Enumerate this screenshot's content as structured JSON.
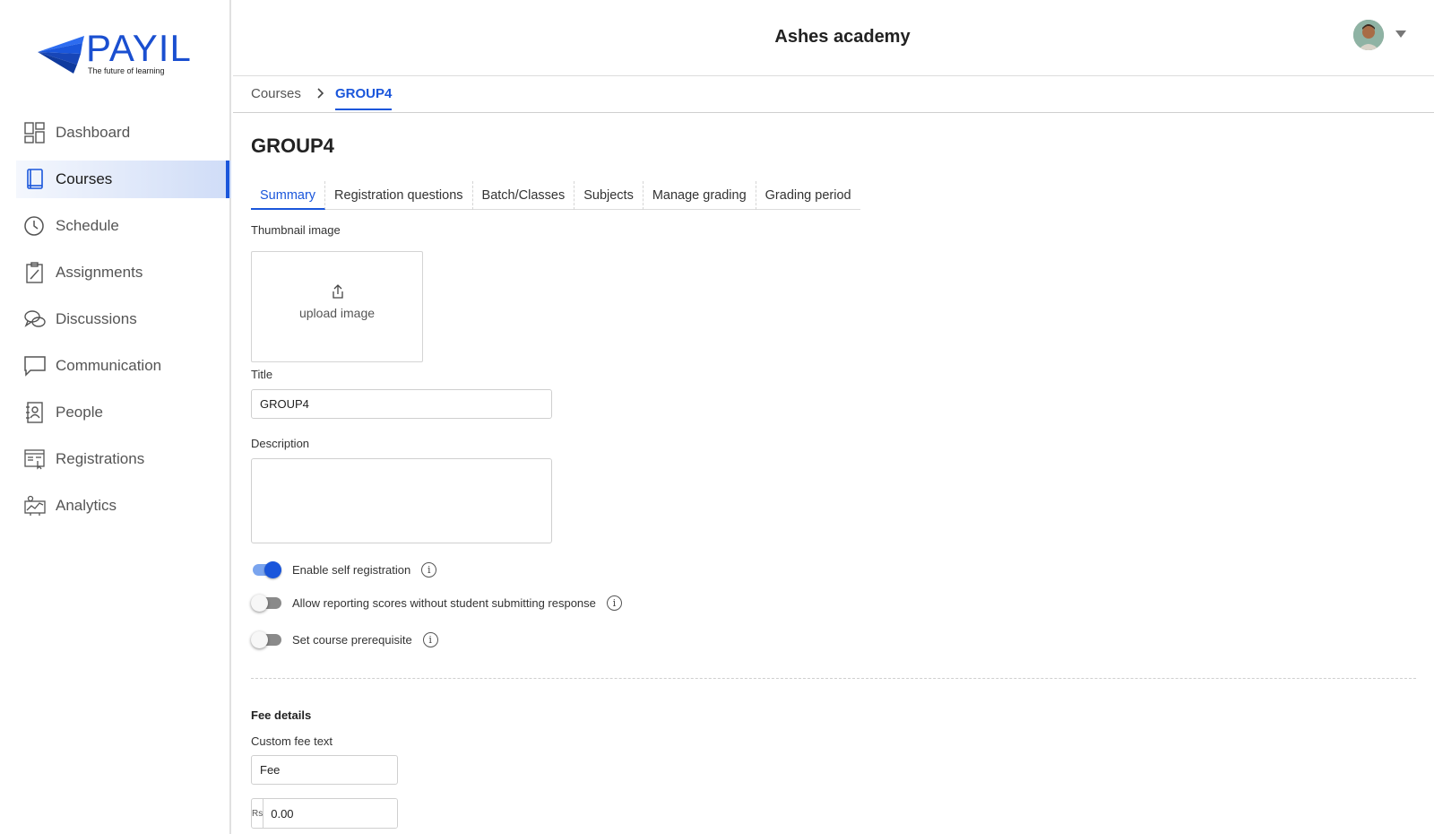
{
  "brand": {
    "name": "PAYIL",
    "tagline": "The future of learning",
    "accent": "#1a56db"
  },
  "header": {
    "title": "Ashes academy",
    "avatar_icon": "user-avatar",
    "menu_icon": "caret-down-icon"
  },
  "sidebar": {
    "items": [
      {
        "label": "Dashboard",
        "icon": "dashboard-icon",
        "active": false
      },
      {
        "label": "Courses",
        "icon": "book-icon",
        "active": true
      },
      {
        "label": "Schedule",
        "icon": "clock-icon",
        "active": false
      },
      {
        "label": "Assignments",
        "icon": "clipboard-icon",
        "active": false
      },
      {
        "label": "Discussions",
        "icon": "chat-bubbles-icon",
        "active": false
      },
      {
        "label": "Communication",
        "icon": "message-icon",
        "active": false
      },
      {
        "label": "People",
        "icon": "contacts-icon",
        "active": false
      },
      {
        "label": "Registrations",
        "icon": "form-icon",
        "active": false
      },
      {
        "label": "Analytics",
        "icon": "analytics-icon",
        "active": false
      }
    ]
  },
  "breadcrumb": {
    "root": "Courses",
    "separator": ">",
    "current": "GROUP4"
  },
  "page": {
    "title": "GROUP4",
    "tabs": [
      {
        "label": "Summary",
        "active": true
      },
      {
        "label": "Registration questions",
        "active": false
      },
      {
        "label": "Batch/Classes",
        "active": false
      },
      {
        "label": "Subjects",
        "active": false
      },
      {
        "label": "Manage grading",
        "active": false
      },
      {
        "label": "Grading period",
        "active": false
      }
    ]
  },
  "form": {
    "thumbnail": {
      "label": "Thumbnail image",
      "upload_text": "upload image"
    },
    "title": {
      "label": "Title",
      "value": "GROUP4"
    },
    "description": {
      "label": "Description",
      "value": ""
    },
    "toggles": [
      {
        "label": "Enable self registration",
        "on": true
      },
      {
        "label": "Allow reporting scores without student submitting response",
        "on": false
      },
      {
        "label": "Set course prerequisite",
        "on": false
      }
    ],
    "fee": {
      "section_title": "Fee details",
      "custom_fee_label": "Custom fee text",
      "custom_fee_value": "Fee",
      "currency_prefix": "Rs",
      "amount": "0.00"
    }
  }
}
